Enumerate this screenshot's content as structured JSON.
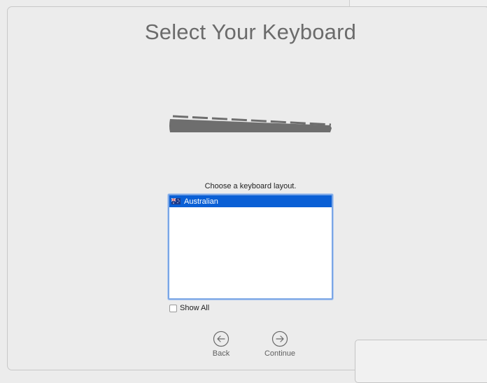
{
  "title": "Select Your Keyboard",
  "prompt": "Choose a keyboard layout.",
  "layouts": [
    {
      "label": "Australian",
      "selected": true,
      "flag_icon": "australia-flag-icon"
    }
  ],
  "show_all": {
    "label": "Show All",
    "checked": false
  },
  "nav": {
    "back_label": "Back",
    "continue_label": "Continue"
  },
  "colors": {
    "accent": "#0a5fd5",
    "list_border": "#7aa6e6",
    "title": "#6b6b6b"
  }
}
